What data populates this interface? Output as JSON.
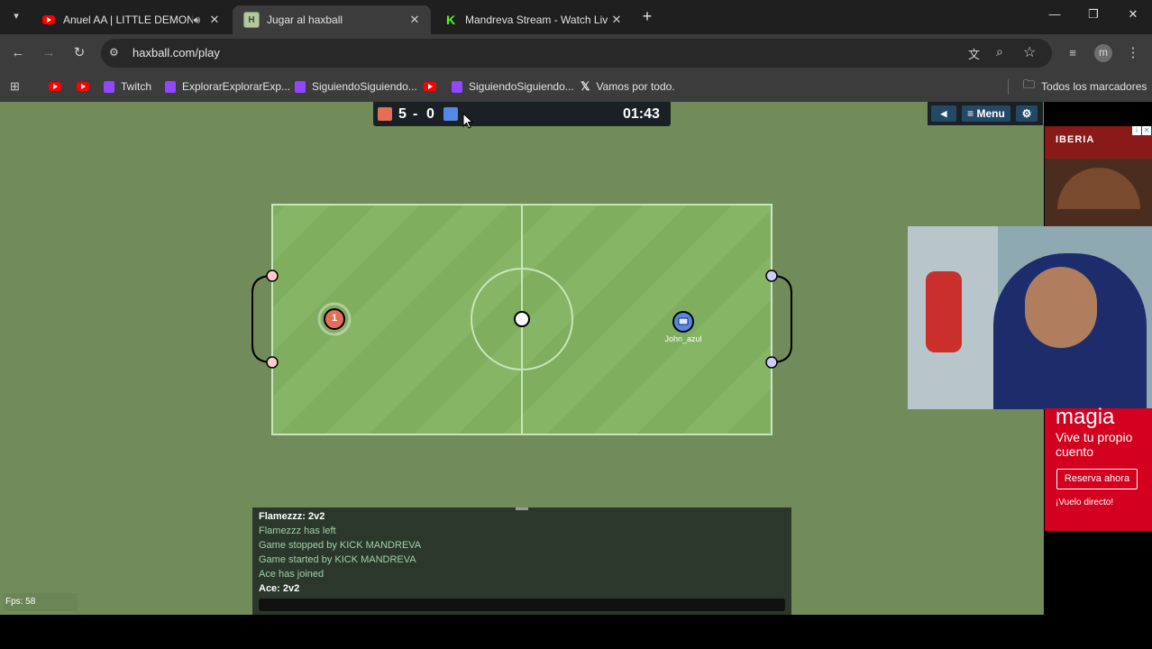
{
  "browser": {
    "tabs": [
      {
        "title": "Anuel AA | LITTLE DEMON",
        "active": false,
        "favicon": "youtube-icon",
        "audio": true
      },
      {
        "title": "Jugar al haxball",
        "active": true,
        "favicon": "haxball-icon"
      },
      {
        "title": "Mandreva Stream - Watch Live",
        "active": false,
        "favicon": "kick-icon"
      }
    ],
    "new_tab": "+",
    "url": "haxball.com/play",
    "bookmarks": [
      {
        "label": "",
        "icon": "youtube-icon"
      },
      {
        "label": "",
        "icon": "youtube-icon"
      },
      {
        "label": "Twitch",
        "icon": "twitch-icon"
      },
      {
        "label": "ExplorarExplorarExp...",
        "icon": "twitch-icon"
      },
      {
        "label": "SiguiendoSiguiendo...",
        "icon": "twitch-icon"
      },
      {
        "label": "",
        "icon": "youtube-icon"
      },
      {
        "label": "SiguiendoSiguiendo...",
        "icon": "twitch-icon"
      },
      {
        "label": "Vamos por todo.",
        "icon": "x-icon"
      }
    ],
    "all_bookmarks": "Todos los marcadores",
    "profile_initial": "m"
  },
  "game": {
    "score_red": "5",
    "score_sep": "-",
    "score_blue": "0",
    "timer": "01:43",
    "menu_label": "Menu",
    "red_player_number": "1",
    "blue_player_name": "John_azul",
    "fps": "Fps: 58"
  },
  "chat": {
    "lines": [
      {
        "text": "Flamezzz: 2v2",
        "bold": true
      },
      {
        "text": "Flamezzz has left",
        "bold": false
      },
      {
        "text": "Game stopped by KICK MANDREVA",
        "bold": false
      },
      {
        "text": "Game started by KICK MANDREVA",
        "bold": false
      },
      {
        "text": "Ace has joined",
        "bold": false
      },
      {
        "text": "Ace: 2v2",
        "bold": true
      }
    ]
  },
  "ads": {
    "iberia_logo": "IBERIA",
    "magia_title": "magia",
    "magia_tagline": "Vive tu propio cuento",
    "magia_cta": "Reserva ahora",
    "magia_footer": "¡Vuelo directo!"
  },
  "colors": {
    "field": "#7fae5e",
    "background": "#718c5a",
    "red_team": "#e56e56",
    "blue_team": "#5689e5"
  }
}
